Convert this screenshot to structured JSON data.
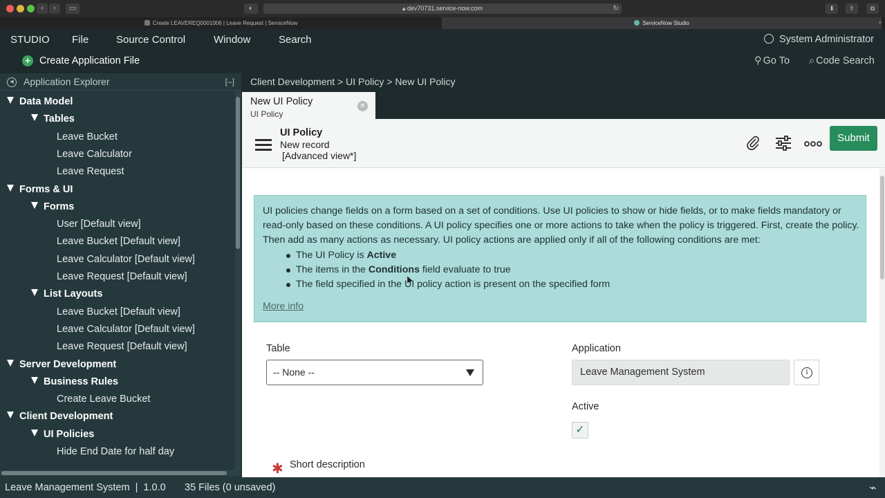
{
  "browser": {
    "url": "dev70731.service-now.com",
    "tabs": [
      {
        "label": "Create LEAVEREQ0001006 | Leave Request | ServiceNow",
        "active": false
      },
      {
        "label": "ServiceNow Studio",
        "active": true
      }
    ],
    "icons": {
      "back": "chevron-left-icon",
      "forward": "chevron-right-icon",
      "sidebar": "sidebar-icon",
      "shield": "shield-icon",
      "reload": "reload-icon",
      "download": "download-icon",
      "share": "share-icon",
      "tabs": "tabs-icon",
      "new_tab": "plus-icon"
    }
  },
  "menubar": {
    "items": [
      "STUDIO",
      "File",
      "Source Control",
      "Window",
      "Search"
    ],
    "user": "System Administrator"
  },
  "toolbar": {
    "create_label": "Create Application File",
    "goto_label": "Go To",
    "code_search_label": "Code Search"
  },
  "explorer": {
    "title": "Application Explorer",
    "collapse_label": "[–]",
    "tree": [
      {
        "label": "Data Model",
        "level": 0,
        "expanded": true
      },
      {
        "label": "Tables",
        "level": 1,
        "expanded": true
      },
      {
        "label": "Leave Bucket",
        "level": 2
      },
      {
        "label": "Leave Calculator",
        "level": 2
      },
      {
        "label": "Leave Request",
        "level": 2
      },
      {
        "label": "Forms & UI",
        "level": 0,
        "expanded": true
      },
      {
        "label": "Forms",
        "level": 1,
        "expanded": true
      },
      {
        "label": "User [Default view]",
        "level": 2
      },
      {
        "label": "Leave Bucket [Default view]",
        "level": 2
      },
      {
        "label": "Leave Calculator [Default view]",
        "level": 2
      },
      {
        "label": "Leave Request [Default view]",
        "level": 2
      },
      {
        "label": "List Layouts",
        "level": 1,
        "expanded": true
      },
      {
        "label": "Leave Bucket [Default view]",
        "level": 2
      },
      {
        "label": "Leave Calculator [Default view]",
        "level": 2
      },
      {
        "label": "Leave Request [Default view]",
        "level": 2
      },
      {
        "label": "Server Development",
        "level": 0,
        "expanded": true
      },
      {
        "label": "Business Rules",
        "level": 1,
        "expanded": true
      },
      {
        "label": "Create Leave Bucket",
        "level": 2
      },
      {
        "label": "Client Development",
        "level": 0,
        "expanded": true
      },
      {
        "label": "UI Policies",
        "level": 1,
        "expanded": true
      },
      {
        "label": "Hide End Date for half day",
        "level": 2
      }
    ]
  },
  "breadcrumb": "Client Development > UI Policy > New UI Policy",
  "doc_tab": {
    "title": "New UI Policy",
    "subtitle": "UI Policy"
  },
  "form_header": {
    "title": "UI Policy",
    "subtitle": "New record",
    "view": "[Advanced view*]",
    "submit_label": "Submit",
    "icons": [
      "paperclip-icon",
      "sliders-icon",
      "more-icon"
    ]
  },
  "info": {
    "paragraph": "UI policies change fields on a form based on a set of conditions. Use UI policies to show or hide fields, or to make fields mandatory or read-only based on these conditions. A UI policy specifies one or more actions to take when the policy is triggered. First, create the policy. Then add as many actions as necessary. UI policy actions are applied only if all of the following conditions are met:",
    "bullets": [
      {
        "pre": "The UI Policy is ",
        "bold": "Active",
        "post": ""
      },
      {
        "pre": "The items in the ",
        "bold": "Conditions",
        "post": " field evaluate to true"
      },
      {
        "pre": "The field specified in the UI policy action is present on the specified form",
        "bold": "",
        "post": ""
      }
    ],
    "more_info": "More info"
  },
  "fields": {
    "table_label": "Table",
    "table_value": "-- None --",
    "application_label": "Application",
    "application_value": "Leave Management System",
    "active_label": "Active",
    "active_checked": true,
    "short_description_label": "Short description"
  },
  "statusbar": {
    "app": "Leave Management System  |  1.0.0",
    "files": "35 Files (0 unsaved)"
  },
  "colors": {
    "studio_bg": "#1e2a2c",
    "explorer_bg": "#25393c",
    "submit": "#278c5b",
    "info_bg": "#abdcd9"
  }
}
